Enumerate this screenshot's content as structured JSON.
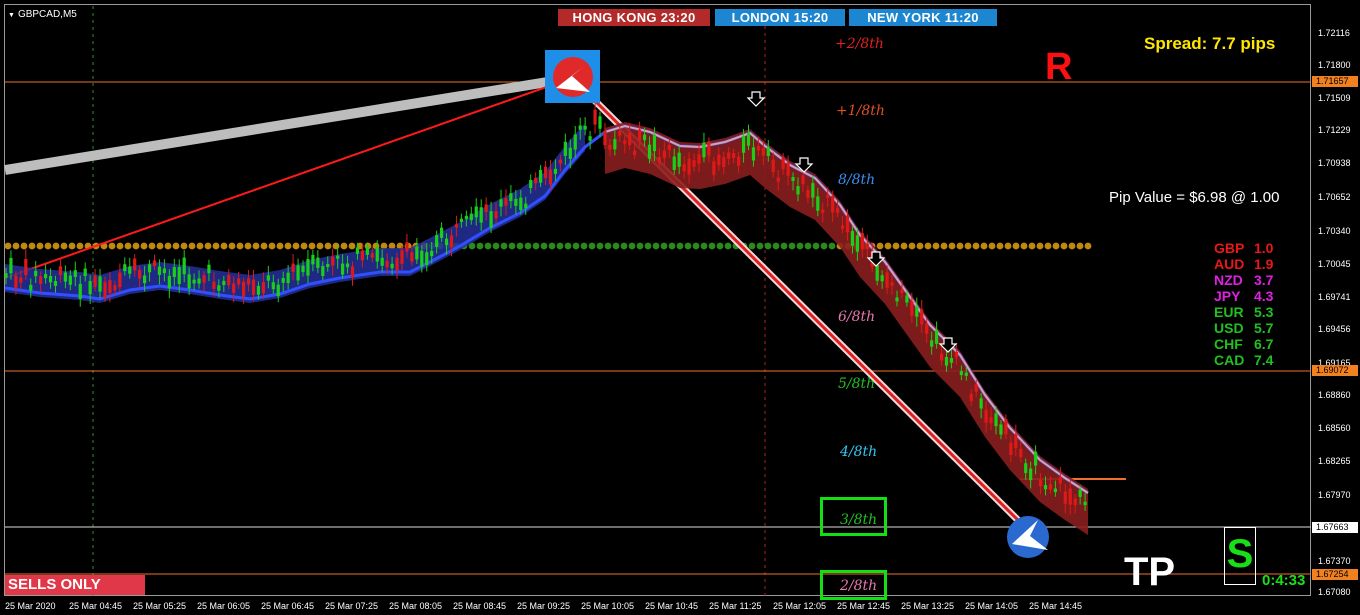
{
  "symbol": "GBPCAD,M5",
  "sessions": {
    "hong_kong": "HONG KONG  23:20",
    "london": "LONDON   15:20",
    "new_york": "NEW YORK  11:20"
  },
  "spread": "Spread: 7.7 pips",
  "pip_value": "Pip Value = $6.98 @ 1.00",
  "markers": {
    "r": "R",
    "tp": "TP",
    "s": "S"
  },
  "countdown": "0:4:33",
  "sells_only": "SELLS ONLY",
  "murray_levels": [
    {
      "label": "+2/8th",
      "color": "#e02020"
    },
    {
      "label": "+1/8th",
      "color": "#e05020"
    },
    {
      "label": "8/8th",
      "color": "#3a8ef0"
    },
    {
      "label": "6/8th",
      "color": "#e878b0"
    },
    {
      "label": "5/8th",
      "color": "#20c020"
    },
    {
      "label": "4/8th",
      "color": "#30c8f0"
    },
    {
      "label": "3/8th",
      "color": "#20c020"
    },
    {
      "label": "2/8th",
      "color": "#e878b0"
    }
  ],
  "currency_strength": [
    {
      "currency": "GBP",
      "value": "1.0",
      "color": "#e81818"
    },
    {
      "currency": "AUD",
      "value": "1.9",
      "color": "#e81818"
    },
    {
      "currency": "NZD",
      "value": "3.7",
      "color": "#e020e0"
    },
    {
      "currency": "JPY",
      "value": "4.3",
      "color": "#e020e0"
    },
    {
      "currency": "EUR",
      "value": "5.3",
      "color": "#20c020"
    },
    {
      "currency": "USD",
      "value": "5.7",
      "color": "#20c020"
    },
    {
      "currency": "CHF",
      "value": "6.7",
      "color": "#20c020"
    },
    {
      "currency": "CAD",
      "value": "7.4",
      "color": "#20c020"
    }
  ],
  "price_axis": [
    "1.72116",
    "1.71800",
    "1.71509",
    "1.71229",
    "1.70938",
    "1.70652",
    "1.70340",
    "1.70045",
    "1.69741",
    "1.69456",
    "1.69165",
    "1.68860",
    "1.68560",
    "1.68265",
    "1.67970",
    "1.67370",
    "1.67080"
  ],
  "price_tags": [
    {
      "label": "1.71657",
      "bg": "#f08020",
      "fg": "#000"
    },
    {
      "label": "1.69072",
      "bg": "#f08020",
      "fg": "#000"
    },
    {
      "label": "1.67663",
      "bg": "#ffffff",
      "fg": "#000"
    },
    {
      "label": "1.67254",
      "bg": "#f08020",
      "fg": "#000"
    }
  ],
  "time_axis": [
    "25 Mar 2020",
    "25 Mar 04:45",
    "25 Mar 05:25",
    "25 Mar 06:05",
    "25 Mar 06:45",
    "25 Mar 07:25",
    "25 Mar 08:05",
    "25 Mar 08:45",
    "25 Mar 09:25",
    "25 Mar 10:05",
    "25 Mar 10:45",
    "25 Mar 11:25",
    "25 Mar 12:05",
    "25 Mar 12:45",
    "25 Mar 13:25",
    "25 Mar 14:05",
    "25 Mar 14:45"
  ],
  "colors": {
    "bull_candle": "#18d018",
    "bear_candle": "#e01818",
    "bull_cloud": "#25309a",
    "bear_cloud": "#8a1e1e",
    "resistance_line": "#f07030",
    "dotted_band": "#c08a10"
  }
}
